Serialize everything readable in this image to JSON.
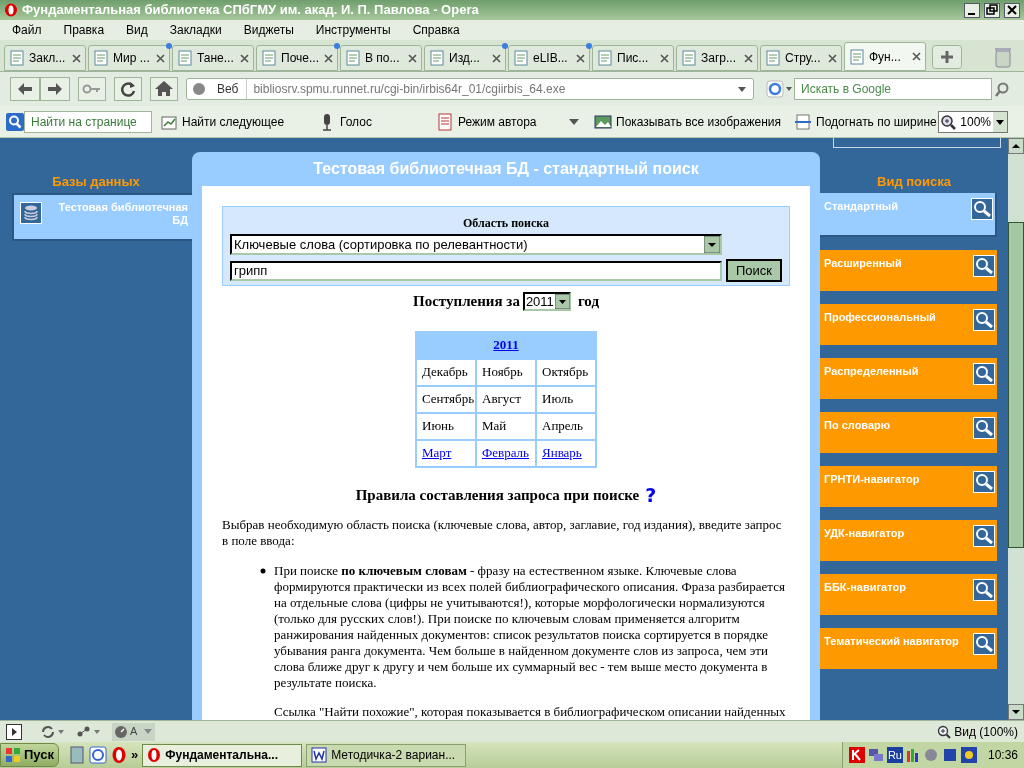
{
  "window": {
    "title": "Фундаментальная библиотека СПбГМУ им. акад. И. П. Павлова - Opera"
  },
  "menu": [
    "Файл",
    "Правка",
    "Вид",
    "Закладки",
    "Виджеты",
    "Инструменты",
    "Справка"
  ],
  "tabs": [
    {
      "label": "Закл...",
      "selected": false,
      "unread": false
    },
    {
      "label": "Мир ...",
      "selected": false,
      "unread": true
    },
    {
      "label": "Тане...",
      "selected": false,
      "unread": false
    },
    {
      "label": "Поче...",
      "selected": false,
      "unread": true
    },
    {
      "label": "В по...",
      "selected": false,
      "unread": false
    },
    {
      "label": "Изд...",
      "selected": false,
      "unread": true
    },
    {
      "label": "eLIB...",
      "selected": false,
      "unread": true
    },
    {
      "label": "Пис...",
      "selected": false,
      "unread": false
    },
    {
      "label": "Загр...",
      "selected": false,
      "unread": false
    },
    {
      "label": "Стру...",
      "selected": false,
      "unread": false
    },
    {
      "label": "Фун...",
      "selected": true,
      "unread": false
    }
  ],
  "address_bar": {
    "scope": "Веб",
    "url": "bibliosrv.spmu.runnet.ru/cgi-bin/irbis64r_01/cgiirbis_64.exe",
    "search_placeholder": "Искать в Google"
  },
  "toolbar": {
    "find_placeholder": "Найти на странице",
    "buttons": [
      "Найти следующее",
      "Голос",
      "Режим автора",
      "Показывать все изображения",
      "Подогнать по ширине"
    ],
    "zoom": "100%"
  },
  "page": {
    "databases": {
      "heading": "Базы данных",
      "items": [
        {
          "label": "Тестовая библиотечная БД",
          "selected": true
        }
      ]
    },
    "main": {
      "title": "Тестовая библиотечная БД - стандартный поиск",
      "search_area": {
        "label": "Область поиска",
        "field": "Ключевые слова (сортировка по релевантности)",
        "query": "грипп",
        "button": "Поиск"
      },
      "arrivals": {
        "prefix": "Поступления за",
        "year": "2011",
        "suffix": "год"
      },
      "calendar": {
        "year": "2011",
        "months": [
          {
            "label": "Декабрь",
            "link": false
          },
          {
            "label": "Ноябрь",
            "link": false
          },
          {
            "label": "Октябрь",
            "link": false
          },
          {
            "label": "Сентябрь",
            "link": false
          },
          {
            "label": "Август",
            "link": false
          },
          {
            "label": "Июль",
            "link": false
          },
          {
            "label": "Июнь",
            "link": false
          },
          {
            "label": "Май",
            "link": false
          },
          {
            "label": "Апрель",
            "link": false
          },
          {
            "label": "Март",
            "link": true
          },
          {
            "label": "Февраль",
            "link": true
          },
          {
            "label": "Январь",
            "link": true
          }
        ]
      },
      "rules": {
        "heading": "Правила составления запроса при поиске",
        "help": "?",
        "intro": "Выбрав необходимую область поиска (ключевые слова, автор, заглавие, год издания), введите запрос в поле ввода:",
        "items": [
          "При поиске **по ключевым словам** - фразу на естественном языке. Ключевые слова формируются практически из всех полей библиографического описания. Фраза разбирается на отдельные слова (цифры не учитываются!), которые морфологически нормализуются (только для русских слов!). При поиске по ключевым словам применяется алгоритм ранжирования найденных документов: список результатов поиска сортируется в порядке убывания ранга документа. Чем больше в найденном документе слов из запроса, чем эти слова ближе друг к другу и чем больше их суммарный вес - тем выше место документа в результате поиска."
        ],
        "note": "Ссылка \"Найти похожие\", которая показывается в библиографическом описании найденных"
      }
    },
    "search_types": {
      "heading": "Вид поиска",
      "items": [
        {
          "label": "Стандартный",
          "selected": true
        },
        {
          "label": "Расширенный",
          "selected": false
        },
        {
          "label": "Профессиональный",
          "selected": false
        },
        {
          "label": "Распределенный",
          "selected": false
        },
        {
          "label": "По словарю",
          "selected": false
        },
        {
          "label": "ГРНТИ-навигатор",
          "selected": false
        },
        {
          "label": "УДК-навигатор",
          "selected": false
        },
        {
          "label": "ББК-навигатор",
          "selected": false
        },
        {
          "label": "Тематический навигатор",
          "selected": false
        }
      ]
    }
  },
  "status_bar": {
    "indicator": "A",
    "zoom": "Вид (100%)"
  },
  "taskbar": {
    "start": "Пуск",
    "more": "»",
    "tasks": [
      {
        "label": "Фундаментальна...",
        "selected": true
      },
      {
        "label": "Методичка-2 вариан...",
        "selected": false
      }
    ],
    "language": "Ru",
    "clock": "10:36"
  }
}
